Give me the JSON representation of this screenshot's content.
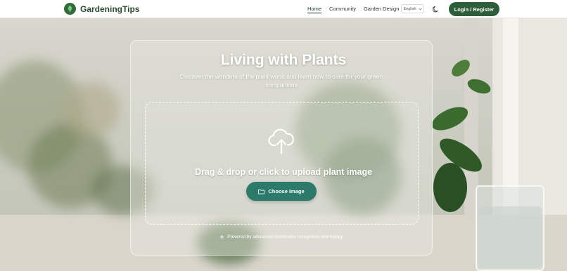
{
  "header": {
    "brand": "GardeningTips",
    "nav": [
      "Home",
      "Community",
      "Garden Design"
    ],
    "language": "English",
    "login_label": "Login / Register"
  },
  "hero": {
    "title": "Living with Plants",
    "subtitle": "Discover the wonders of the plant world and learn how to care for your green companions"
  },
  "upload": {
    "prompt": "Drag & drop or click to upload plant image",
    "button_label": "Choose Image",
    "footnote": "Powered by advanced multimodal recognition technology"
  },
  "colors": {
    "brand_green": "#2e5d3a",
    "accent_teal": "#2b7a6a"
  },
  "icons": [
    "leaf-logo-icon",
    "chevron-down-icon",
    "moon-icon",
    "cloud-upload-icon",
    "folder-icon",
    "sparkle-icon"
  ]
}
